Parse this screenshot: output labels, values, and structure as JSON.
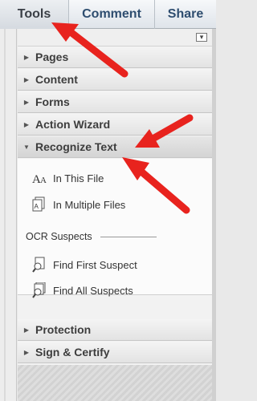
{
  "tabs": [
    {
      "label": "Tools"
    },
    {
      "label": "Comment"
    },
    {
      "label": "Share"
    }
  ],
  "sections": {
    "pages": "Pages",
    "content": "Content",
    "forms": "Forms",
    "action_wizard": "Action Wizard",
    "recognize_text": "Recognize Text",
    "protection": "Protection",
    "sign_certify": "Sign & Certify"
  },
  "recognize_text": {
    "items": [
      {
        "label": "In This File"
      },
      {
        "label": "In Multiple Files"
      }
    ],
    "ocr_heading": "OCR Suspects",
    "ocr_items": [
      {
        "label": "Find First Suspect"
      },
      {
        "label": "Find All Suspects"
      }
    ]
  },
  "colors": {
    "tab_text": "#2e4d6f",
    "annotation_red": "#e8231e"
  }
}
